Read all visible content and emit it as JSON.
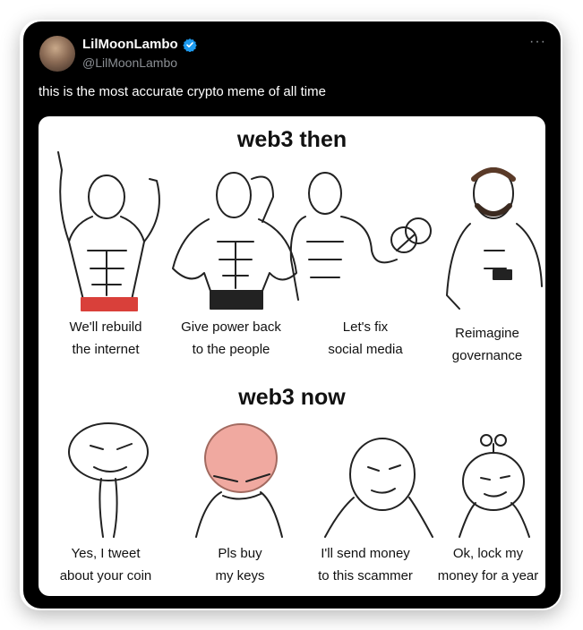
{
  "tweet": {
    "display_name": "LilMoonLambo",
    "handle": "@LilMoonLambo",
    "verified_icon": "verified-badge-icon",
    "more_icon": "more-options-icon",
    "text": "this is the most accurate crypto meme of all time"
  },
  "meme": {
    "then_title": "web3 then",
    "now_title": "web3 now",
    "then_captions": [
      {
        "line1": "We'll rebuild",
        "line2": "the internet"
      },
      {
        "line1": "Give power back",
        "line2": "to the people"
      },
      {
        "line1": "Let's fix",
        "line2": "social media"
      },
      {
        "line1": "Reimagine",
        "line2": "governance"
      }
    ],
    "now_captions": [
      {
        "line1": "Yes, I tweet",
        "line2": "about your coin"
      },
      {
        "line1": "Pls buy",
        "line2": "my keys"
      },
      {
        "line1": "I'll send money",
        "line2": "to this scammer"
      },
      {
        "line1": "Ok, lock my",
        "line2": "money for a year"
      }
    ]
  },
  "colors": {
    "background": "#000000",
    "brand_verified": "#1d9bf0",
    "brain_pink": "#f0a9a0",
    "shorts_red": "#d9403a"
  }
}
